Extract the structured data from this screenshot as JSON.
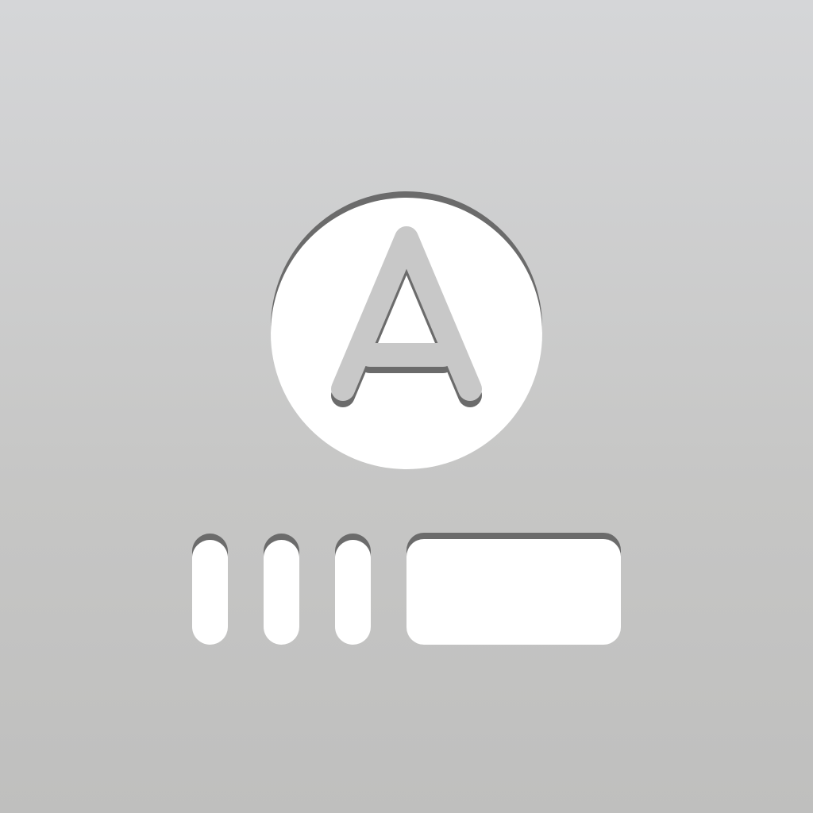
{
  "app": {
    "icon_name": "font-glyph-app-icon",
    "glyph": "A",
    "colors": {
      "background_top": "#d5d6d8",
      "background_bottom": "#bfbfbe",
      "foreground": "#ffffff",
      "shadow": "#6b6b6b"
    }
  },
  "elements": {
    "top": "letter-circle-icon",
    "bottom_left": "vertical-bars-icon",
    "bottom_right": "rounded-rectangle-icon"
  }
}
